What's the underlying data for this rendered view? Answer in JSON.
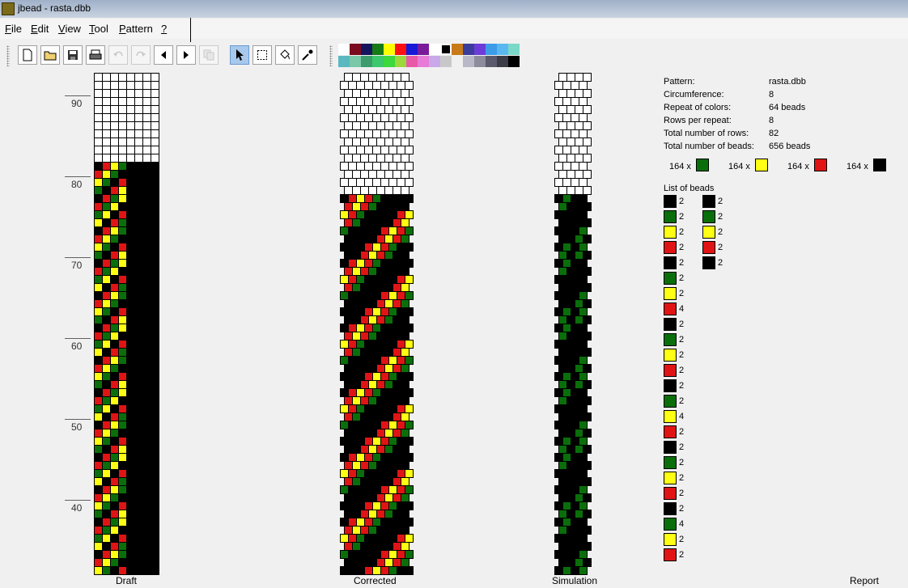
{
  "window": {
    "title": "jbead - rasta.dbb"
  },
  "menu": [
    {
      "label": "File",
      "key": "F"
    },
    {
      "label": "Edit",
      "key": "E"
    },
    {
      "label": "View",
      "key": "V"
    },
    {
      "label": "Tool",
      "key": "T"
    },
    {
      "label": "Pattern",
      "key": "P"
    },
    {
      "label": "?",
      "key": "?"
    }
  ],
  "toolbar": {
    "icons": [
      "new-file-icon",
      "open-folder-icon",
      "save-icon",
      "print-icon",
      "undo-icon",
      "redo-icon",
      "arrow-left-icon",
      "arrow-right-icon",
      "copy-icon",
      "pointer-icon",
      "select-rect-icon",
      "fill-bucket-icon",
      "eyedropper-icon"
    ],
    "palette_row1": [
      "#ffffff",
      "#7b0a1e",
      "#15155e",
      "#167a16",
      "#ffff00",
      "#ff1010",
      "#1818d8",
      "#7a1a9a",
      "#ffffff",
      "#000000",
      "#c87a18",
      "#3c3c9c",
      "#6c3cd8",
      "#3c9ce8",
      "#5ab8f0",
      "#7ad8c8"
    ],
    "palette_row2": [
      "#5ab8c0",
      "#7ac8a8",
      "#3c9c6c",
      "#3cc86c",
      "#3cd83c",
      "#9cd83c",
      "#e85aa8",
      "#e87ad8",
      "#c8a8e8",
      "#c8c8c8",
      "#f0f0f0",
      "#b8b8c8",
      "#8c8c9c",
      "#5a5a6c",
      "#3c3c48",
      "#000000"
    ]
  },
  "ruler": {
    "labels": [
      "90",
      "80",
      "70",
      "60",
      "50",
      "40"
    ]
  },
  "colors": {
    "g": "#0a6e0a",
    "y": "#ffff14",
    "r": "#e01414",
    "k": "#000000",
    "w": "#ffffff"
  },
  "pattern_repeat": [
    "kryg",
    "rygk",
    "ygkr",
    "gkry",
    "krgy",
    "rgyk",
    "gykr",
    "ykrg"
  ],
  "panels": {
    "draft": "Draft",
    "corrected": "Corrected",
    "simulation": "Simulation",
    "report": "Report"
  },
  "info": {
    "rows": [
      {
        "label": "Pattern:",
        "value": "rasta.dbb"
      },
      {
        "label": "Circumference:",
        "value": "8"
      },
      {
        "label": "Repeat of colors:",
        "value": "64 beads"
      },
      {
        "label": "Rows per repeat:",
        "value": "8"
      },
      {
        "label": "Total number of rows:",
        "value": "82"
      },
      {
        "label": "Total number of beads:",
        "value": "656 beads"
      }
    ],
    "bead_counts": [
      {
        "count": "164 x",
        "color": "#0a6e0a"
      },
      {
        "count": "164 x",
        "color": "#ffff14"
      },
      {
        "count": "164 x",
        "color": "#e01414"
      },
      {
        "count": "164 x",
        "color": "#000000"
      }
    ],
    "list_title": "List of beads",
    "list_col1": [
      {
        "c": "k",
        "n": "2"
      },
      {
        "c": "g",
        "n": "2"
      },
      {
        "c": "y",
        "n": "2"
      },
      {
        "c": "r",
        "n": "2"
      },
      {
        "c": "k",
        "n": "2"
      },
      {
        "c": "g",
        "n": "2"
      },
      {
        "c": "y",
        "n": "2"
      },
      {
        "c": "r",
        "n": "4"
      },
      {
        "c": "k",
        "n": "2"
      },
      {
        "c": "g",
        "n": "2"
      },
      {
        "c": "y",
        "n": "2"
      },
      {
        "c": "r",
        "n": "2"
      },
      {
        "c": "k",
        "n": "2"
      },
      {
        "c": "g",
        "n": "2"
      },
      {
        "c": "y",
        "n": "4"
      },
      {
        "c": "r",
        "n": "2"
      },
      {
        "c": "k",
        "n": "2"
      },
      {
        "c": "g",
        "n": "2"
      },
      {
        "c": "y",
        "n": "2"
      },
      {
        "c": "r",
        "n": "2"
      },
      {
        "c": "k",
        "n": "2"
      },
      {
        "c": "g",
        "n": "4"
      },
      {
        "c": "y",
        "n": "2"
      },
      {
        "c": "r",
        "n": "2"
      }
    ],
    "list_col2": [
      {
        "c": "k",
        "n": "2"
      },
      {
        "c": "g",
        "n": "2"
      },
      {
        "c": "y",
        "n": "2"
      },
      {
        "c": "r",
        "n": "2"
      },
      {
        "c": "k",
        "n": "2"
      }
    ]
  }
}
